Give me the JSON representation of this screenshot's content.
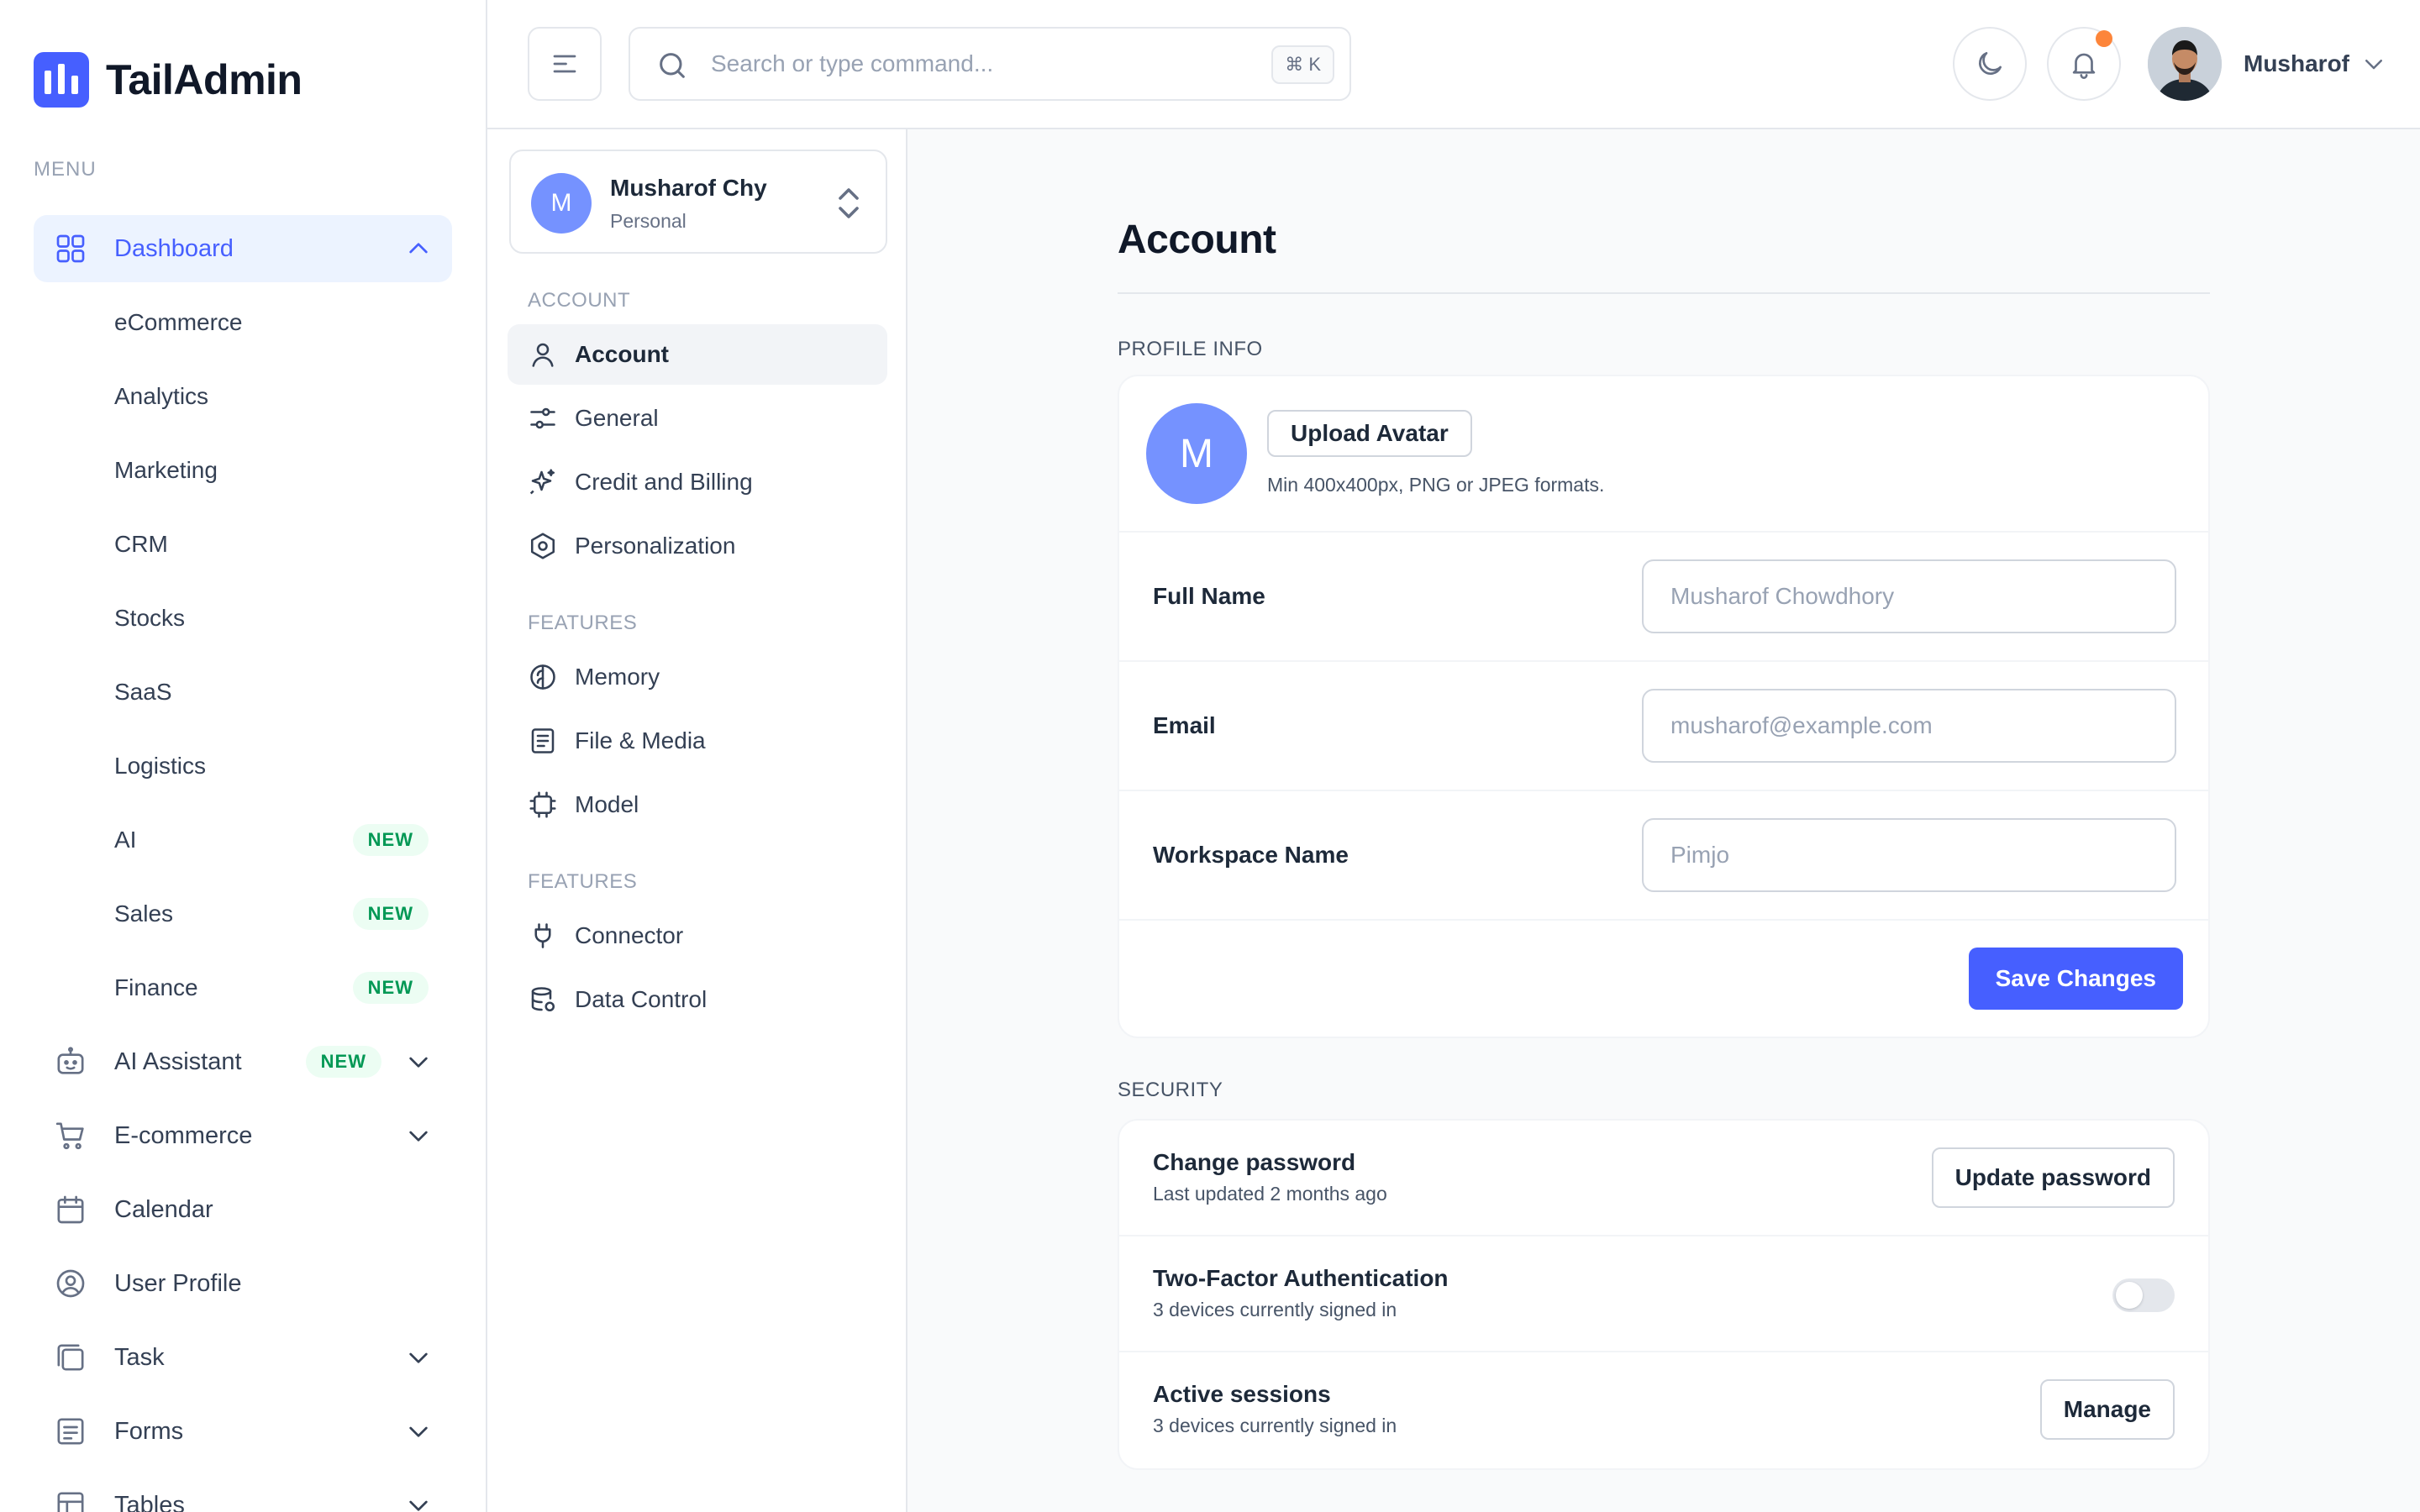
{
  "brand": {
    "name": "TailAdmin"
  },
  "sidebar": {
    "menu_label": "MENU",
    "dashboard": {
      "label": "Dashboard",
      "children": [
        {
          "label": "eCommerce"
        },
        {
          "label": "Analytics"
        },
        {
          "label": "Marketing"
        },
        {
          "label": "CRM"
        },
        {
          "label": "Stocks"
        },
        {
          "label": "SaaS"
        },
        {
          "label": "Logistics"
        },
        {
          "label": "AI",
          "badge": "NEW"
        },
        {
          "label": "Sales",
          "badge": "NEW"
        },
        {
          "label": "Finance",
          "badge": "NEW"
        }
      ]
    },
    "items": [
      {
        "label": "AI Assistant",
        "badge": "NEW",
        "icon": "robot-icon"
      },
      {
        "label": "E-commerce",
        "icon": "cart-icon"
      },
      {
        "label": "Calendar",
        "icon": "calendar-icon"
      },
      {
        "label": "User Profile",
        "icon": "user-circle-icon"
      },
      {
        "label": "Task",
        "icon": "task-icon"
      },
      {
        "label": "Forms",
        "icon": "forms-icon"
      },
      {
        "label": "Tables",
        "icon": "table-icon"
      }
    ]
  },
  "header": {
    "search_placeholder": "Search or type command...",
    "search_shortcut": "⌘ K",
    "user_name": "Musharof"
  },
  "settings_nav": {
    "workspace": {
      "initial": "M",
      "name": "Musharof Chy",
      "type": "Personal"
    },
    "groups": [
      {
        "label": "ACCOUNT",
        "items": [
          {
            "label": "Account",
            "icon": "user-icon"
          },
          {
            "label": "General",
            "icon": "sliders-icon"
          },
          {
            "label": "Credit and Billing",
            "icon": "sparkle-icon"
          },
          {
            "label": "Personalization",
            "icon": "hexagon-icon"
          }
        ]
      },
      {
        "label": "FEATURES",
        "items": [
          {
            "label": "Memory",
            "icon": "brain-icon"
          },
          {
            "label": "File & Media",
            "icon": "file-icon"
          },
          {
            "label": "Model",
            "icon": "chip-icon"
          }
        ]
      },
      {
        "label": "FEATURES",
        "items": [
          {
            "label": "Connector",
            "icon": "plug-icon"
          },
          {
            "label": "Data Control",
            "icon": "database-icon"
          }
        ]
      }
    ]
  },
  "main": {
    "title": "Account",
    "profile": {
      "section_label": "PROFILE INFO",
      "avatar_initial": "M",
      "upload_label": "Upload Avatar",
      "upload_hint": "Min 400x400px, PNG or JPEG formats.",
      "fields": [
        {
          "label": "Full Name",
          "placeholder": "Musharof Chowdhory"
        },
        {
          "label": "Email",
          "placeholder": "musharof@example.com"
        },
        {
          "label": "Workspace Name",
          "placeholder": "Pimjo"
        }
      ],
      "save_label": "Save Changes"
    },
    "security": {
      "section_label": "SECURITY",
      "password": {
        "title": "Change password",
        "subtitle": "Last updated 2 months ago",
        "button": "Update password"
      },
      "two_factor": {
        "title": "Two-Factor Authentication",
        "subtitle": "3 devices currently signed in",
        "enabled": false
      },
      "sessions": {
        "title": "Active sessions",
        "subtitle": "3 devices currently signed in",
        "button": "Manage"
      }
    }
  },
  "colors": {
    "accent": "#465fff",
    "accent_soft": "#ecf3ff",
    "avatar": "#7592ff",
    "badge_text": "#039855",
    "badge_bg": "#ecfdf3",
    "notification": "#fd853a"
  }
}
